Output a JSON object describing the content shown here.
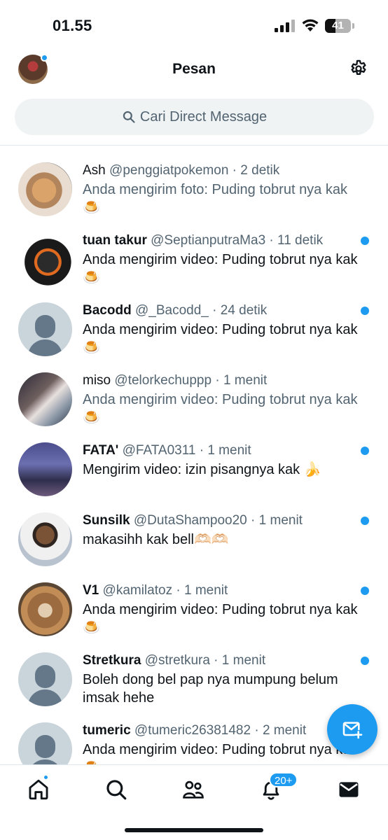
{
  "status_bar": {
    "time": "01.55",
    "battery": "41",
    "battery_level": 0.41
  },
  "header": {
    "title": "Pesan"
  },
  "search": {
    "placeholder": "Cari Direct Message"
  },
  "conversations": [
    {
      "name": "Ash",
      "handle": "@penggiatpokemon",
      "sep": " · ",
      "time": "2 detik",
      "preview": "Anda mengirim foto: Puding tobrut nya kak 🍮",
      "unread": false,
      "avatar": "cat1"
    },
    {
      "name": "tuan takur",
      "handle": "@SeptianputraMa3",
      "sep": " · ",
      "time": "11 detik",
      "preview": "Anda mengirim video: Puding tobrut nya kak🍮",
      "unread": true,
      "avatar": "goku"
    },
    {
      "name": "Bacodd",
      "handle": "@_Bacodd_",
      "sep": " · ",
      "time": "24 detik",
      "preview": "Anda mengirim video: Puding tobrut nya kak🍮",
      "unread": true,
      "avatar": "default"
    },
    {
      "name": "miso",
      "handle": "@telorkechuppp",
      "sep": " · ",
      "time": "1 menit",
      "preview": "Anda mengirim video: Puding tobrut nya kak 🍮",
      "unread": false,
      "avatar": "miso"
    },
    {
      "name": "FATA'",
      "handle": "@FATA0311",
      "sep": " · ",
      "time": "1 menit",
      "preview": "Mengirim video: izin pisangnya kak 🍌",
      "unread": true,
      "avatar": "fata"
    },
    {
      "name": "Sunsilk",
      "handle": "@DutaShampoo20",
      "sep": " · ",
      "time": "1 menit",
      "preview": "makasihh kak bell🫶🏻🫶🏻",
      "unread": true,
      "avatar": "sunsilk"
    },
    {
      "name": "V1",
      "handle": "@kamilatoz",
      "sep": " · ",
      "time": "1 menit",
      "preview": "Anda mengirim video: Puding tobrut nya kak🍮",
      "unread": true,
      "avatar": "cat2"
    },
    {
      "name": "Stretkura",
      "handle": "@stretkura",
      "sep": " · ",
      "time": "1 menit",
      "preview": "Boleh dong bel pap nya mumpung belum imsak hehe",
      "unread": true,
      "avatar": "default"
    },
    {
      "name": "tumeric",
      "handle": "@tumeric26381482",
      "sep": " · ",
      "time": "2 menit",
      "preview": "Anda mengirim video: Puding tobrut nya kak🍮",
      "unread": true,
      "avatar": "default"
    }
  ],
  "nav": {
    "notif_badge": "20+"
  },
  "icons": [
    "settings-icon",
    "search-icon",
    "new-message-icon",
    "home-icon",
    "explore-icon",
    "communities-icon",
    "notifications-icon",
    "messages-icon"
  ],
  "colors": {
    "accent": "#1d9bf0",
    "text": "#0f1419",
    "muted": "#536471"
  }
}
